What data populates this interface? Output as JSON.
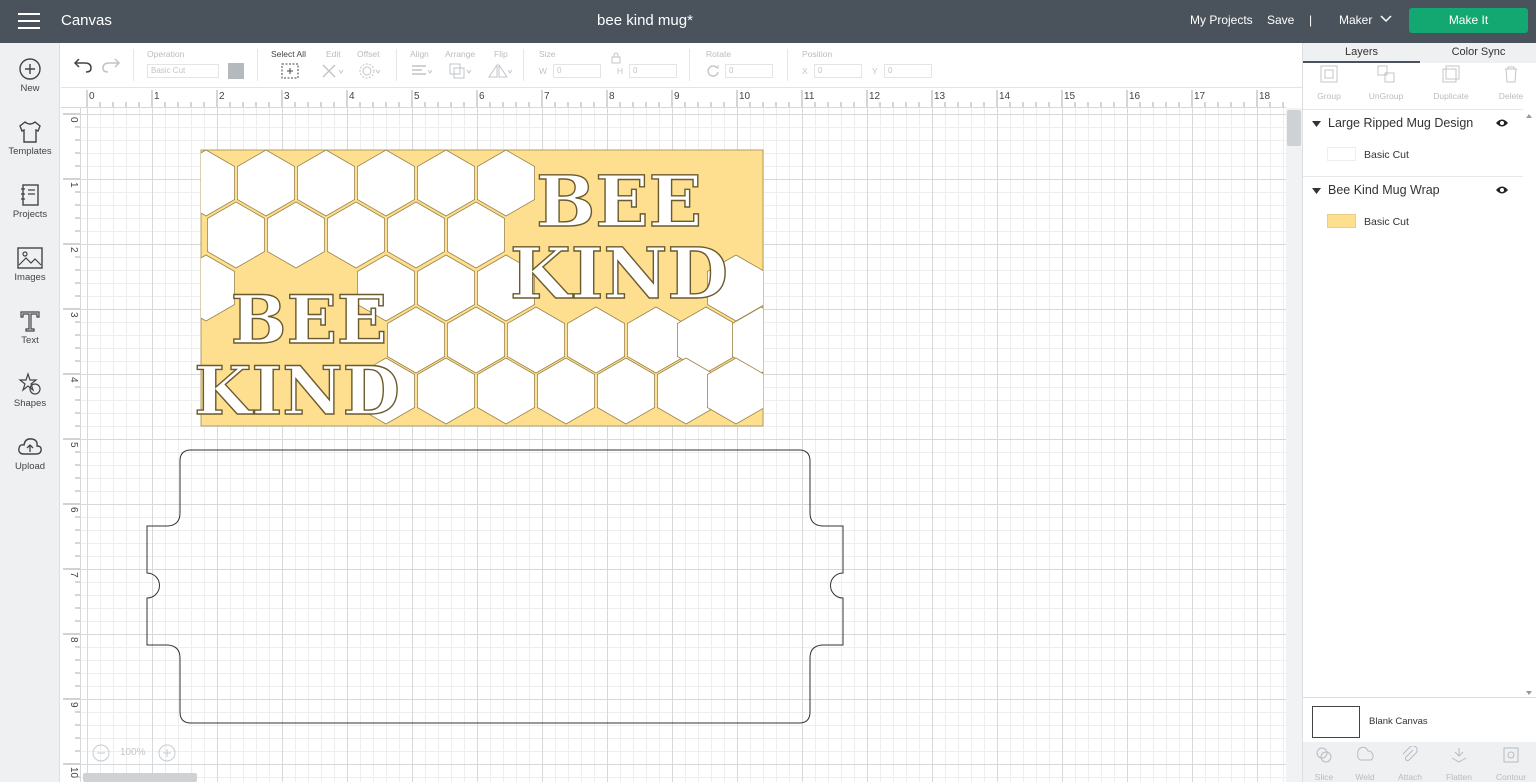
{
  "topbar": {
    "app_title": "Canvas",
    "doc_title": "bee kind mug*",
    "my_projects": "My Projects",
    "save": "Save",
    "separator": "|",
    "machine": "Maker",
    "make_it": "Make It"
  },
  "leftbar": {
    "new": "New",
    "templates": "Templates",
    "projects": "Projects",
    "images": "Images",
    "text": "Text",
    "shapes": "Shapes",
    "upload": "Upload"
  },
  "toolbar": {
    "operation_label": "Operation",
    "operation_value": "Basic Cut",
    "select_all": "Select All",
    "edit": "Edit",
    "offset": "Offset",
    "align": "Align",
    "arrange": "Arrange",
    "flip": "Flip",
    "size": "Size",
    "w": "W",
    "h": "H",
    "w_value": "0",
    "h_value": "0",
    "rotate": "Rotate",
    "rotate_value": "0",
    "position": "Position",
    "x": "X",
    "y": "Y",
    "x_value": "0",
    "y_value": "0"
  },
  "ruler": {
    "h_ticks": [
      "0",
      "1",
      "2",
      "3",
      "4",
      "5",
      "6",
      "7",
      "8",
      "9",
      "10",
      "11",
      "12",
      "13",
      "14",
      "15",
      "16",
      "17",
      "18"
    ],
    "v_ticks": [
      "0",
      "1",
      "2",
      "3",
      "4",
      "5",
      "6",
      "7",
      "8",
      "9",
      "10"
    ]
  },
  "design": {
    "bee_kind_top_line1": "BEE",
    "bee_kind_top_line2": "KIND",
    "bee_kind_bottom_line1": "BEE",
    "bee_kind_bottom_line2": "KIND",
    "fill_color": "#fddf8f"
  },
  "zoom": {
    "value": "100%"
  },
  "rightpanel": {
    "tab_layers": "Layers",
    "tab_color_sync": "Color Sync",
    "tools": {
      "group": "Group",
      "ungroup": "UnGroup",
      "duplicate": "Duplicate",
      "delete": "Delete"
    },
    "layers": [
      {
        "title": "Large Ripped Mug Design",
        "sub": "Basic Cut"
      },
      {
        "title": "Bee Kind Mug Wrap",
        "sub": "Basic Cut"
      }
    ],
    "blank_canvas": "Blank Canvas",
    "bottom_tools": {
      "slice": "Slice",
      "weld": "Weld",
      "attach": "Attach",
      "flatten": "Flatten",
      "contour": "Contour"
    }
  },
  "colors": {
    "topbar": "#4a535c",
    "make_it": "#13a872",
    "accent_yellow": "#fddf8f"
  }
}
